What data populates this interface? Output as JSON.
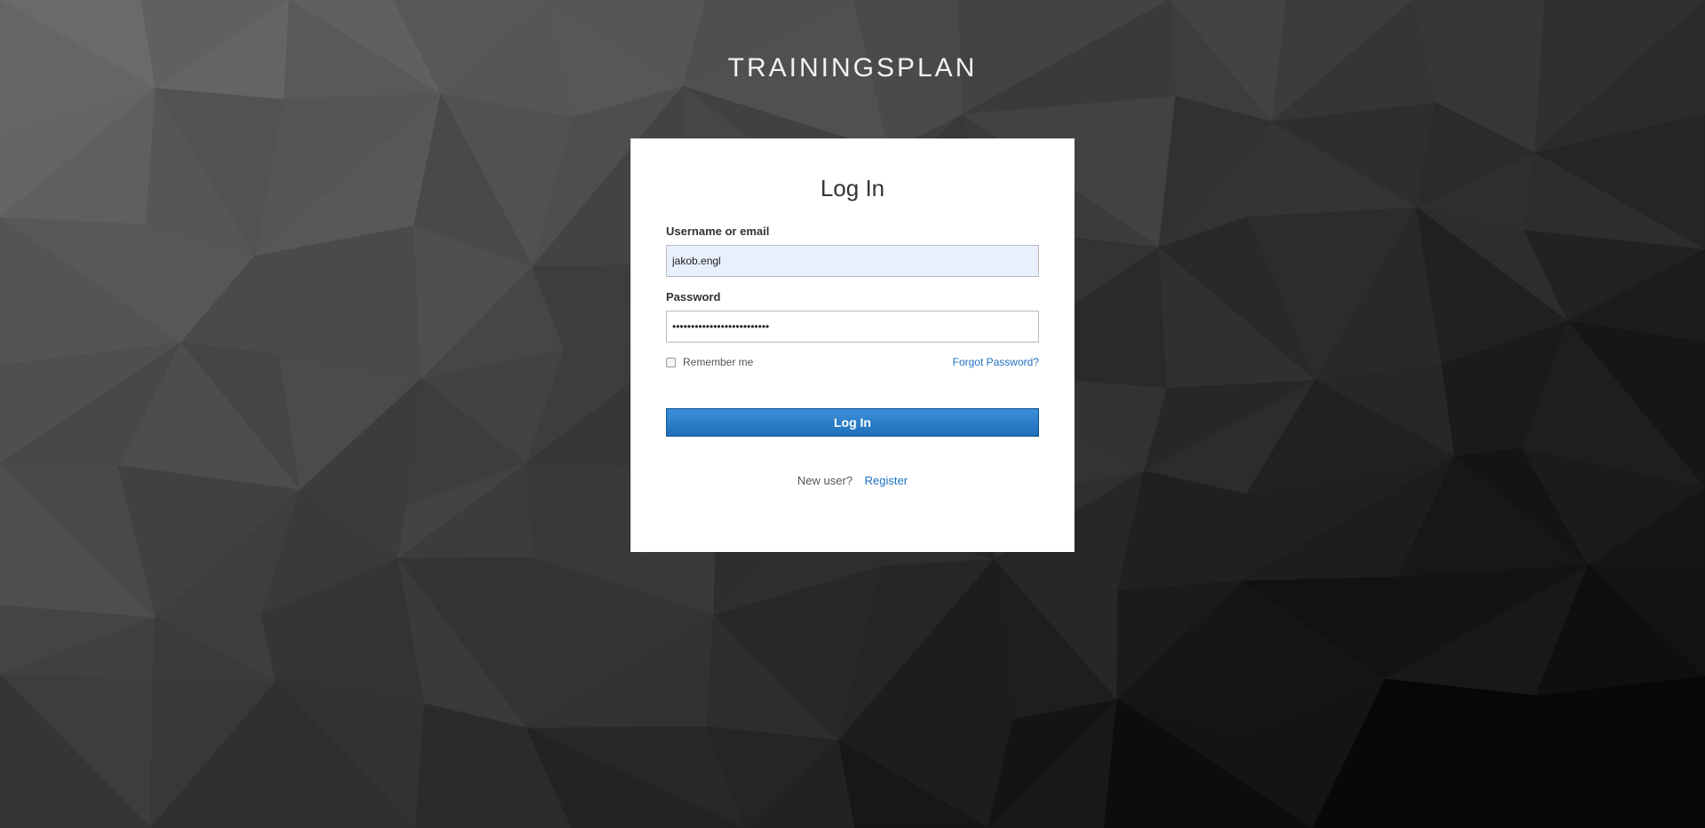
{
  "app": {
    "realm_title": "TRAININGSPLAN"
  },
  "login_form": {
    "heading": "Log In",
    "username": {
      "label": "Username or email",
      "value": "jakob.engl"
    },
    "password": {
      "label": "Password",
      "masked_value": "••••••••••••••••••••••••••"
    },
    "remember_me": {
      "label": "Remember me",
      "checked": false
    },
    "forgot_password_link": "Forgot Password?",
    "submit_label": "Log In",
    "new_user_text": "New user?",
    "register_link": "Register"
  },
  "colors": {
    "link": "#1f70c1",
    "button": "#2a7ccb",
    "autofill_bg": "#e8f0fe"
  }
}
